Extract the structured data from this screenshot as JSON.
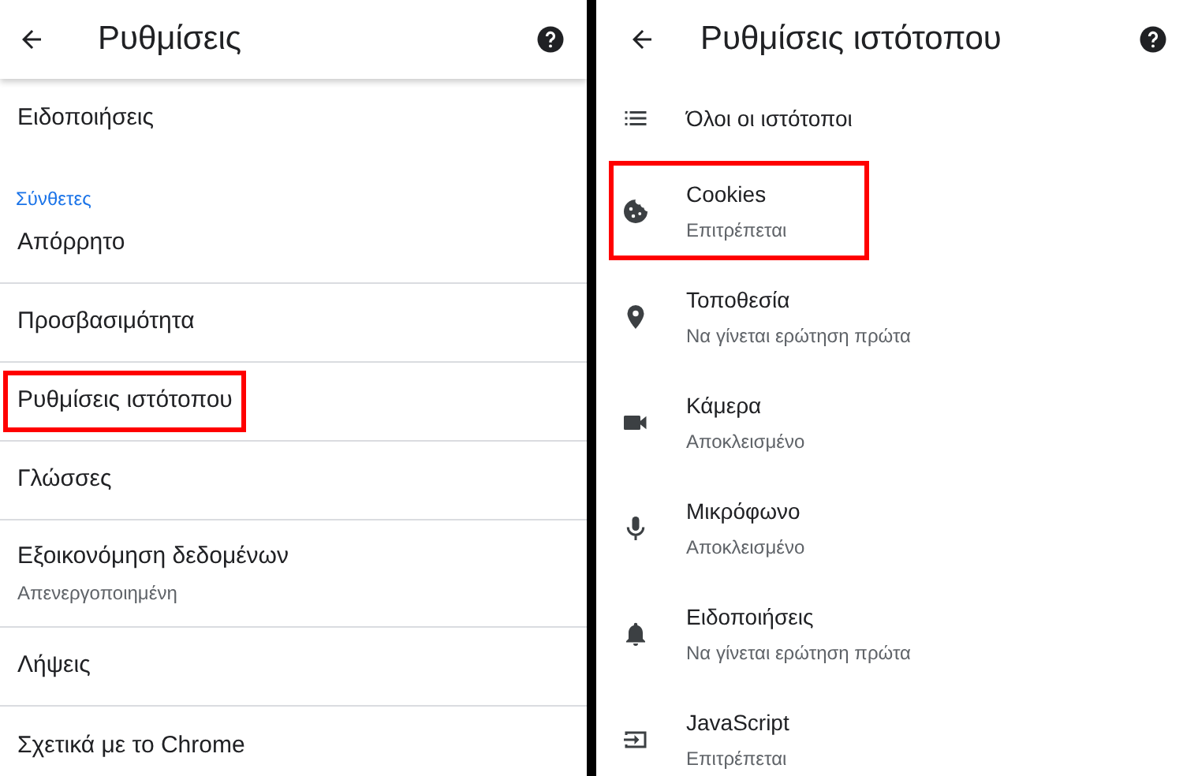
{
  "settings_panel": {
    "title": "Ρυθμίσεις",
    "items": [
      {
        "kind": "item",
        "label": "Ειδοποιήσεις",
        "highlighted": false
      },
      {
        "kind": "section",
        "label": "Σύνθετες"
      },
      {
        "kind": "item",
        "label": "Απόρρητο",
        "highlighted": false
      },
      {
        "kind": "item",
        "label": "Προσβασιμότητα",
        "highlighted": false
      },
      {
        "kind": "item",
        "label": "Ρυθμίσεις ιστότοπου",
        "highlighted": true
      },
      {
        "kind": "item",
        "label": "Γλώσσες",
        "highlighted": false
      },
      {
        "kind": "item",
        "label": "Εξοικονόμηση δεδομένων",
        "subtitle": "Απενεργοποιημένη",
        "highlighted": false
      },
      {
        "kind": "item",
        "label": "Λήψεις",
        "highlighted": false
      },
      {
        "kind": "item",
        "label": "Σχετικά με το Chrome",
        "highlighted": false
      }
    ]
  },
  "site_settings_panel": {
    "title": "Ρυθμίσεις ιστότοπου",
    "items": [
      {
        "kind": "list",
        "label": "Όλοι οι ιστότοποι",
        "highlighted": false
      },
      {
        "kind": "cookie",
        "label": "Cookies",
        "subtitle": "Επιτρέπεται",
        "highlighted": true
      },
      {
        "kind": "location",
        "label": "Τοποθεσία",
        "subtitle": "Να γίνεται ερώτηση πρώτα",
        "highlighted": false
      },
      {
        "kind": "camera",
        "label": "Κάμερα",
        "subtitle": "Αποκλεισμένο",
        "highlighted": false
      },
      {
        "kind": "microphone",
        "label": "Μικρόφωνο",
        "subtitle": "Αποκλεισμένο",
        "highlighted": false
      },
      {
        "kind": "notifications",
        "label": "Ειδοποιήσεις",
        "subtitle": "Να γίνεται ερώτηση πρώτα",
        "highlighted": false
      },
      {
        "kind": "javascript",
        "label": "JavaScript",
        "subtitle": "Επιτρέπεται",
        "highlighted": false
      }
    ]
  }
}
